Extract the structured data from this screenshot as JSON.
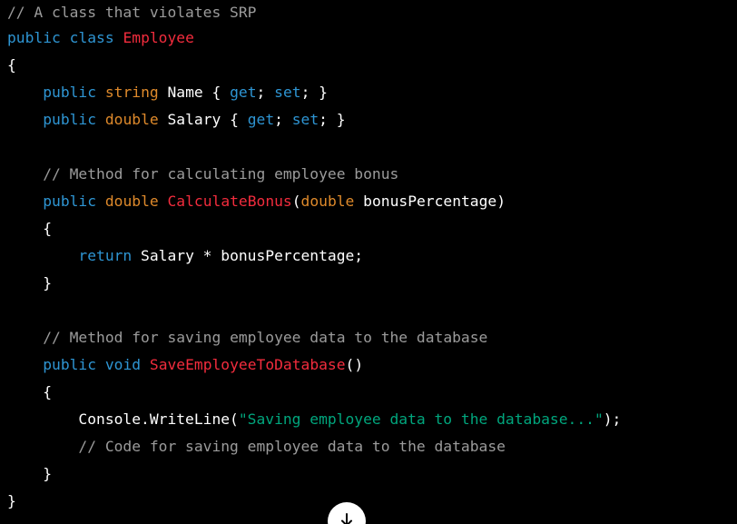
{
  "theme": {
    "background": "#000000",
    "default": "#ffffff",
    "comment": "#9b9b9b",
    "keyword": "#2e95d3",
    "type": "#df8a2b",
    "name": "#f22c3d",
    "string": "#00a67d"
  },
  "code": {
    "language": "csharp",
    "lines": [
      [
        {
          "t": "// A class that violates SRP",
          "k": "comment"
        }
      ],
      [
        {
          "t": "public",
          "k": "keyword"
        },
        {
          "t": " ",
          "k": "default"
        },
        {
          "t": "class",
          "k": "keyword"
        },
        {
          "t": " ",
          "k": "default"
        },
        {
          "t": "Employee",
          "k": "name"
        }
      ],
      [
        {
          "t": "{",
          "k": "default"
        }
      ],
      [
        {
          "t": "    ",
          "k": "default"
        },
        {
          "t": "public",
          "k": "keyword"
        },
        {
          "t": " ",
          "k": "default"
        },
        {
          "t": "string",
          "k": "type"
        },
        {
          "t": " Name { ",
          "k": "default"
        },
        {
          "t": "get",
          "k": "keyword"
        },
        {
          "t": "; ",
          "k": "default"
        },
        {
          "t": "set",
          "k": "keyword"
        },
        {
          "t": "; }",
          "k": "default"
        }
      ],
      [
        {
          "t": "    ",
          "k": "default"
        },
        {
          "t": "public",
          "k": "keyword"
        },
        {
          "t": " ",
          "k": "default"
        },
        {
          "t": "double",
          "k": "type"
        },
        {
          "t": " Salary { ",
          "k": "default"
        },
        {
          "t": "get",
          "k": "keyword"
        },
        {
          "t": "; ",
          "k": "default"
        },
        {
          "t": "set",
          "k": "keyword"
        },
        {
          "t": "; }",
          "k": "default"
        }
      ],
      [],
      [
        {
          "t": "    ",
          "k": "default"
        },
        {
          "t": "// Method for calculating employee bonus",
          "k": "comment"
        }
      ],
      [
        {
          "t": "    ",
          "k": "default"
        },
        {
          "t": "public",
          "k": "keyword"
        },
        {
          "t": " ",
          "k": "default"
        },
        {
          "t": "double",
          "k": "type"
        },
        {
          "t": " ",
          "k": "default"
        },
        {
          "t": "CalculateBonus",
          "k": "name"
        },
        {
          "t": "(",
          "k": "default"
        },
        {
          "t": "double",
          "k": "type"
        },
        {
          "t": " bonusPercentage)",
          "k": "default"
        }
      ],
      [
        {
          "t": "    {",
          "k": "default"
        }
      ],
      [
        {
          "t": "        ",
          "k": "default"
        },
        {
          "t": "return",
          "k": "keyword"
        },
        {
          "t": " Salary * bonusPercentage;",
          "k": "default"
        }
      ],
      [
        {
          "t": "    }",
          "k": "default"
        }
      ],
      [],
      [
        {
          "t": "    ",
          "k": "default"
        },
        {
          "t": "// Method for saving employee data to the database",
          "k": "comment"
        }
      ],
      [
        {
          "t": "    ",
          "k": "default"
        },
        {
          "t": "public",
          "k": "keyword"
        },
        {
          "t": " ",
          "k": "default"
        },
        {
          "t": "void",
          "k": "keyword"
        },
        {
          "t": " ",
          "k": "default"
        },
        {
          "t": "SaveEmployeeToDatabase",
          "k": "name"
        },
        {
          "t": "()",
          "k": "default"
        }
      ],
      [
        {
          "t": "    {",
          "k": "default"
        }
      ],
      [
        {
          "t": "        Console.WriteLine(",
          "k": "default"
        },
        {
          "t": "\"Saving employee data to the database...\"",
          "k": "string"
        },
        {
          "t": ");",
          "k": "default"
        }
      ],
      [
        {
          "t": "        ",
          "k": "default"
        },
        {
          "t": "// Code for saving employee data to the database",
          "k": "comment"
        }
      ],
      [
        {
          "t": "    }",
          "k": "default"
        }
      ],
      [
        {
          "t": "}",
          "k": "default"
        }
      ]
    ]
  },
  "scroll_button": {
    "icon": "arrow-down-icon",
    "background": "#ffffff",
    "icon_color": "#000000"
  }
}
